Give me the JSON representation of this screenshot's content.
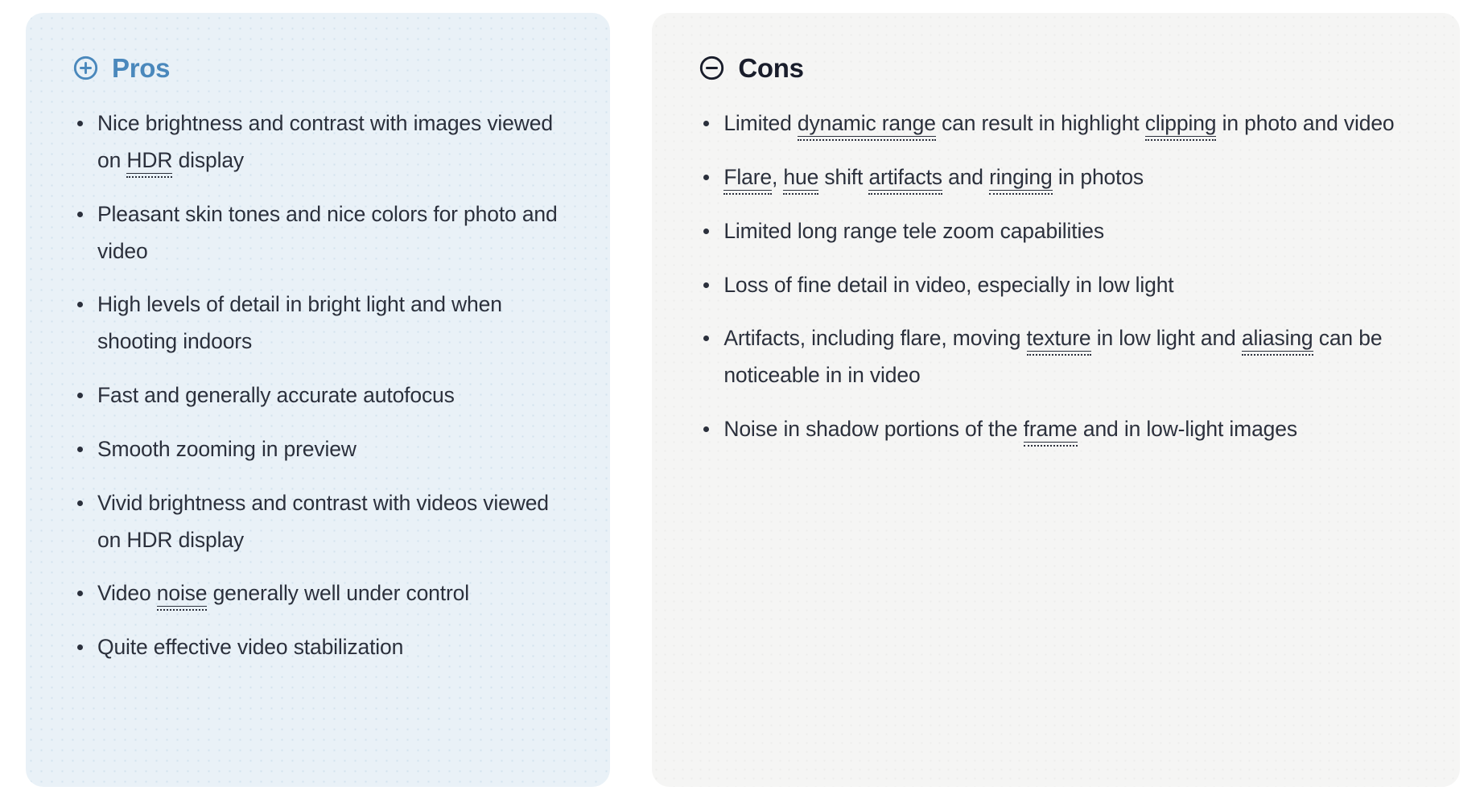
{
  "pros": {
    "icon": "circle-plus-icon",
    "title": "Pros",
    "accent_color": "#4a88bc",
    "background_color": "#e9f1f7",
    "items": [
      [
        {
          "t": "Nice brightness and contrast with images viewed on "
        },
        {
          "t": "HDR",
          "term": true
        },
        {
          "t": " display"
        }
      ],
      [
        {
          "t": "Pleasant skin tones and nice colors for photo and video"
        }
      ],
      [
        {
          "t": "High levels of detail in bright light and when shooting indoors"
        }
      ],
      [
        {
          "t": "Fast and generally accurate autofocus"
        }
      ],
      [
        {
          "t": "Smooth zooming in preview"
        }
      ],
      [
        {
          "t": "Vivid brightness and contrast with videos viewed on HDR display"
        }
      ],
      [
        {
          "t": "Video "
        },
        {
          "t": "noise",
          "term": true
        },
        {
          "t": " generally well under control"
        }
      ],
      [
        {
          "t": "Quite effective video stabilization"
        }
      ]
    ]
  },
  "cons": {
    "icon": "circle-minus-icon",
    "title": "Cons",
    "accent_color": "#191d2b",
    "background_color": "#f5f5f4",
    "items": [
      [
        {
          "t": "Limited "
        },
        {
          "t": "dynamic range",
          "term": true
        },
        {
          "t": " can result in highlight "
        },
        {
          "t": "clipping",
          "term": true
        },
        {
          "t": " in photo and video"
        }
      ],
      [
        {
          "t": "Flare",
          "term": true
        },
        {
          "t": ", "
        },
        {
          "t": "hue",
          "term": true
        },
        {
          "t": " shift "
        },
        {
          "t": "artifacts",
          "term": true
        },
        {
          "t": " and "
        },
        {
          "t": "ringing",
          "term": true
        },
        {
          "t": " in photos"
        }
      ],
      [
        {
          "t": "Limited long range tele zoom capabilities"
        }
      ],
      [
        {
          "t": "Loss of fine detail in video, especially in low light"
        }
      ],
      [
        {
          "t": "Artifacts, including flare, moving "
        },
        {
          "t": "texture",
          "term": true
        },
        {
          "t": " in low light and "
        },
        {
          "t": "aliasing",
          "term": true
        },
        {
          "t": " can be noticeable in in video"
        }
      ],
      [
        {
          "t": "Noise in shadow portions of the "
        },
        {
          "t": "frame",
          "term": true
        },
        {
          "t": " and in low-light images"
        }
      ]
    ]
  }
}
